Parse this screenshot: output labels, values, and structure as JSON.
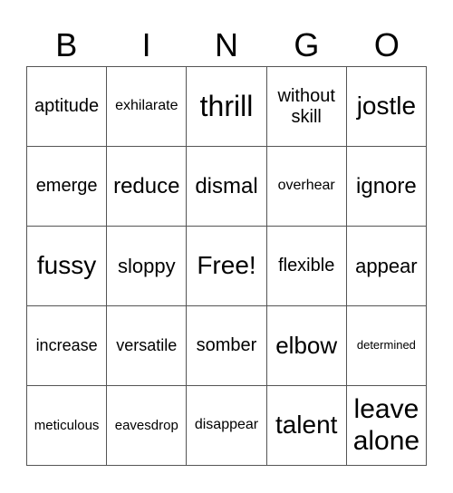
{
  "header": [
    "B",
    "I",
    "N",
    "G",
    "O"
  ],
  "cells": [
    [
      "aptitude",
      "exhilarate",
      "thrill",
      "without skill",
      "jostle"
    ],
    [
      "emerge",
      "reduce",
      "dismal",
      "overhear",
      "ignore"
    ],
    [
      "fussy",
      "sloppy",
      "Free!",
      "flexible",
      "appear"
    ],
    [
      "increase",
      "versatile",
      "somber",
      "elbow",
      "determined"
    ],
    [
      "meticulous",
      "eavesdrop",
      "disappear",
      "talent",
      "leave alone"
    ]
  ]
}
